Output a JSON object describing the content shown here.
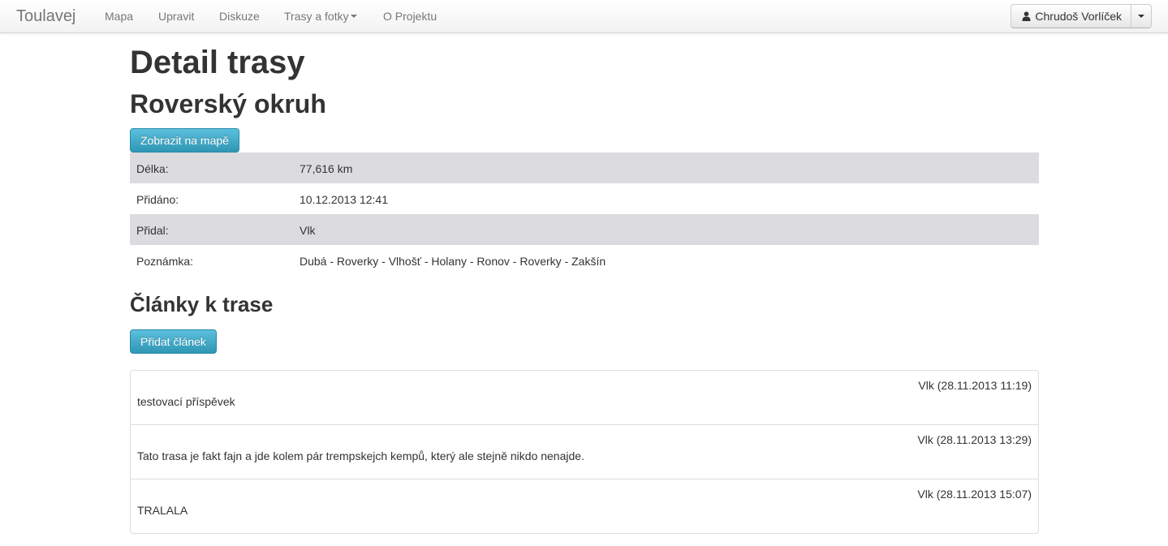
{
  "navbar": {
    "brand": "Toulavej",
    "items": [
      "Mapa",
      "Upravit",
      "Diskuze",
      "Trasy a fotky",
      "O Projektu"
    ],
    "user": "Chrudoš Vorlíček"
  },
  "page": {
    "title": "Detail trasy",
    "route_name": "Roverský okruh",
    "show_map_button": "Zobrazit na mapě"
  },
  "details": [
    {
      "label": "Délka:",
      "value": "77,616 km"
    },
    {
      "label": "Přidáno:",
      "value": "10.12.2013 12:41"
    },
    {
      "label": "Přidal:",
      "value": "Vlk"
    },
    {
      "label": "Poznámka:",
      "value": "Dubá - Roverky - Vlhošť - Holany - Ronov - Roverky - Zakšín"
    }
  ],
  "articles": {
    "heading": "Články k trase",
    "add_button": "Přidat článek",
    "items": [
      {
        "meta": "Vlk (28.11.2013 11:19)",
        "text": "testovací příspěvek"
      },
      {
        "meta": "Vlk (28.11.2013 13:29)",
        "text": "Tato trasa je fakt fajn a jde kolem pár trempskejch kempů, který ale stejně nikdo nenajde."
      },
      {
        "meta": "Vlk (28.11.2013 15:07)",
        "text": "TRALALA"
      }
    ]
  }
}
